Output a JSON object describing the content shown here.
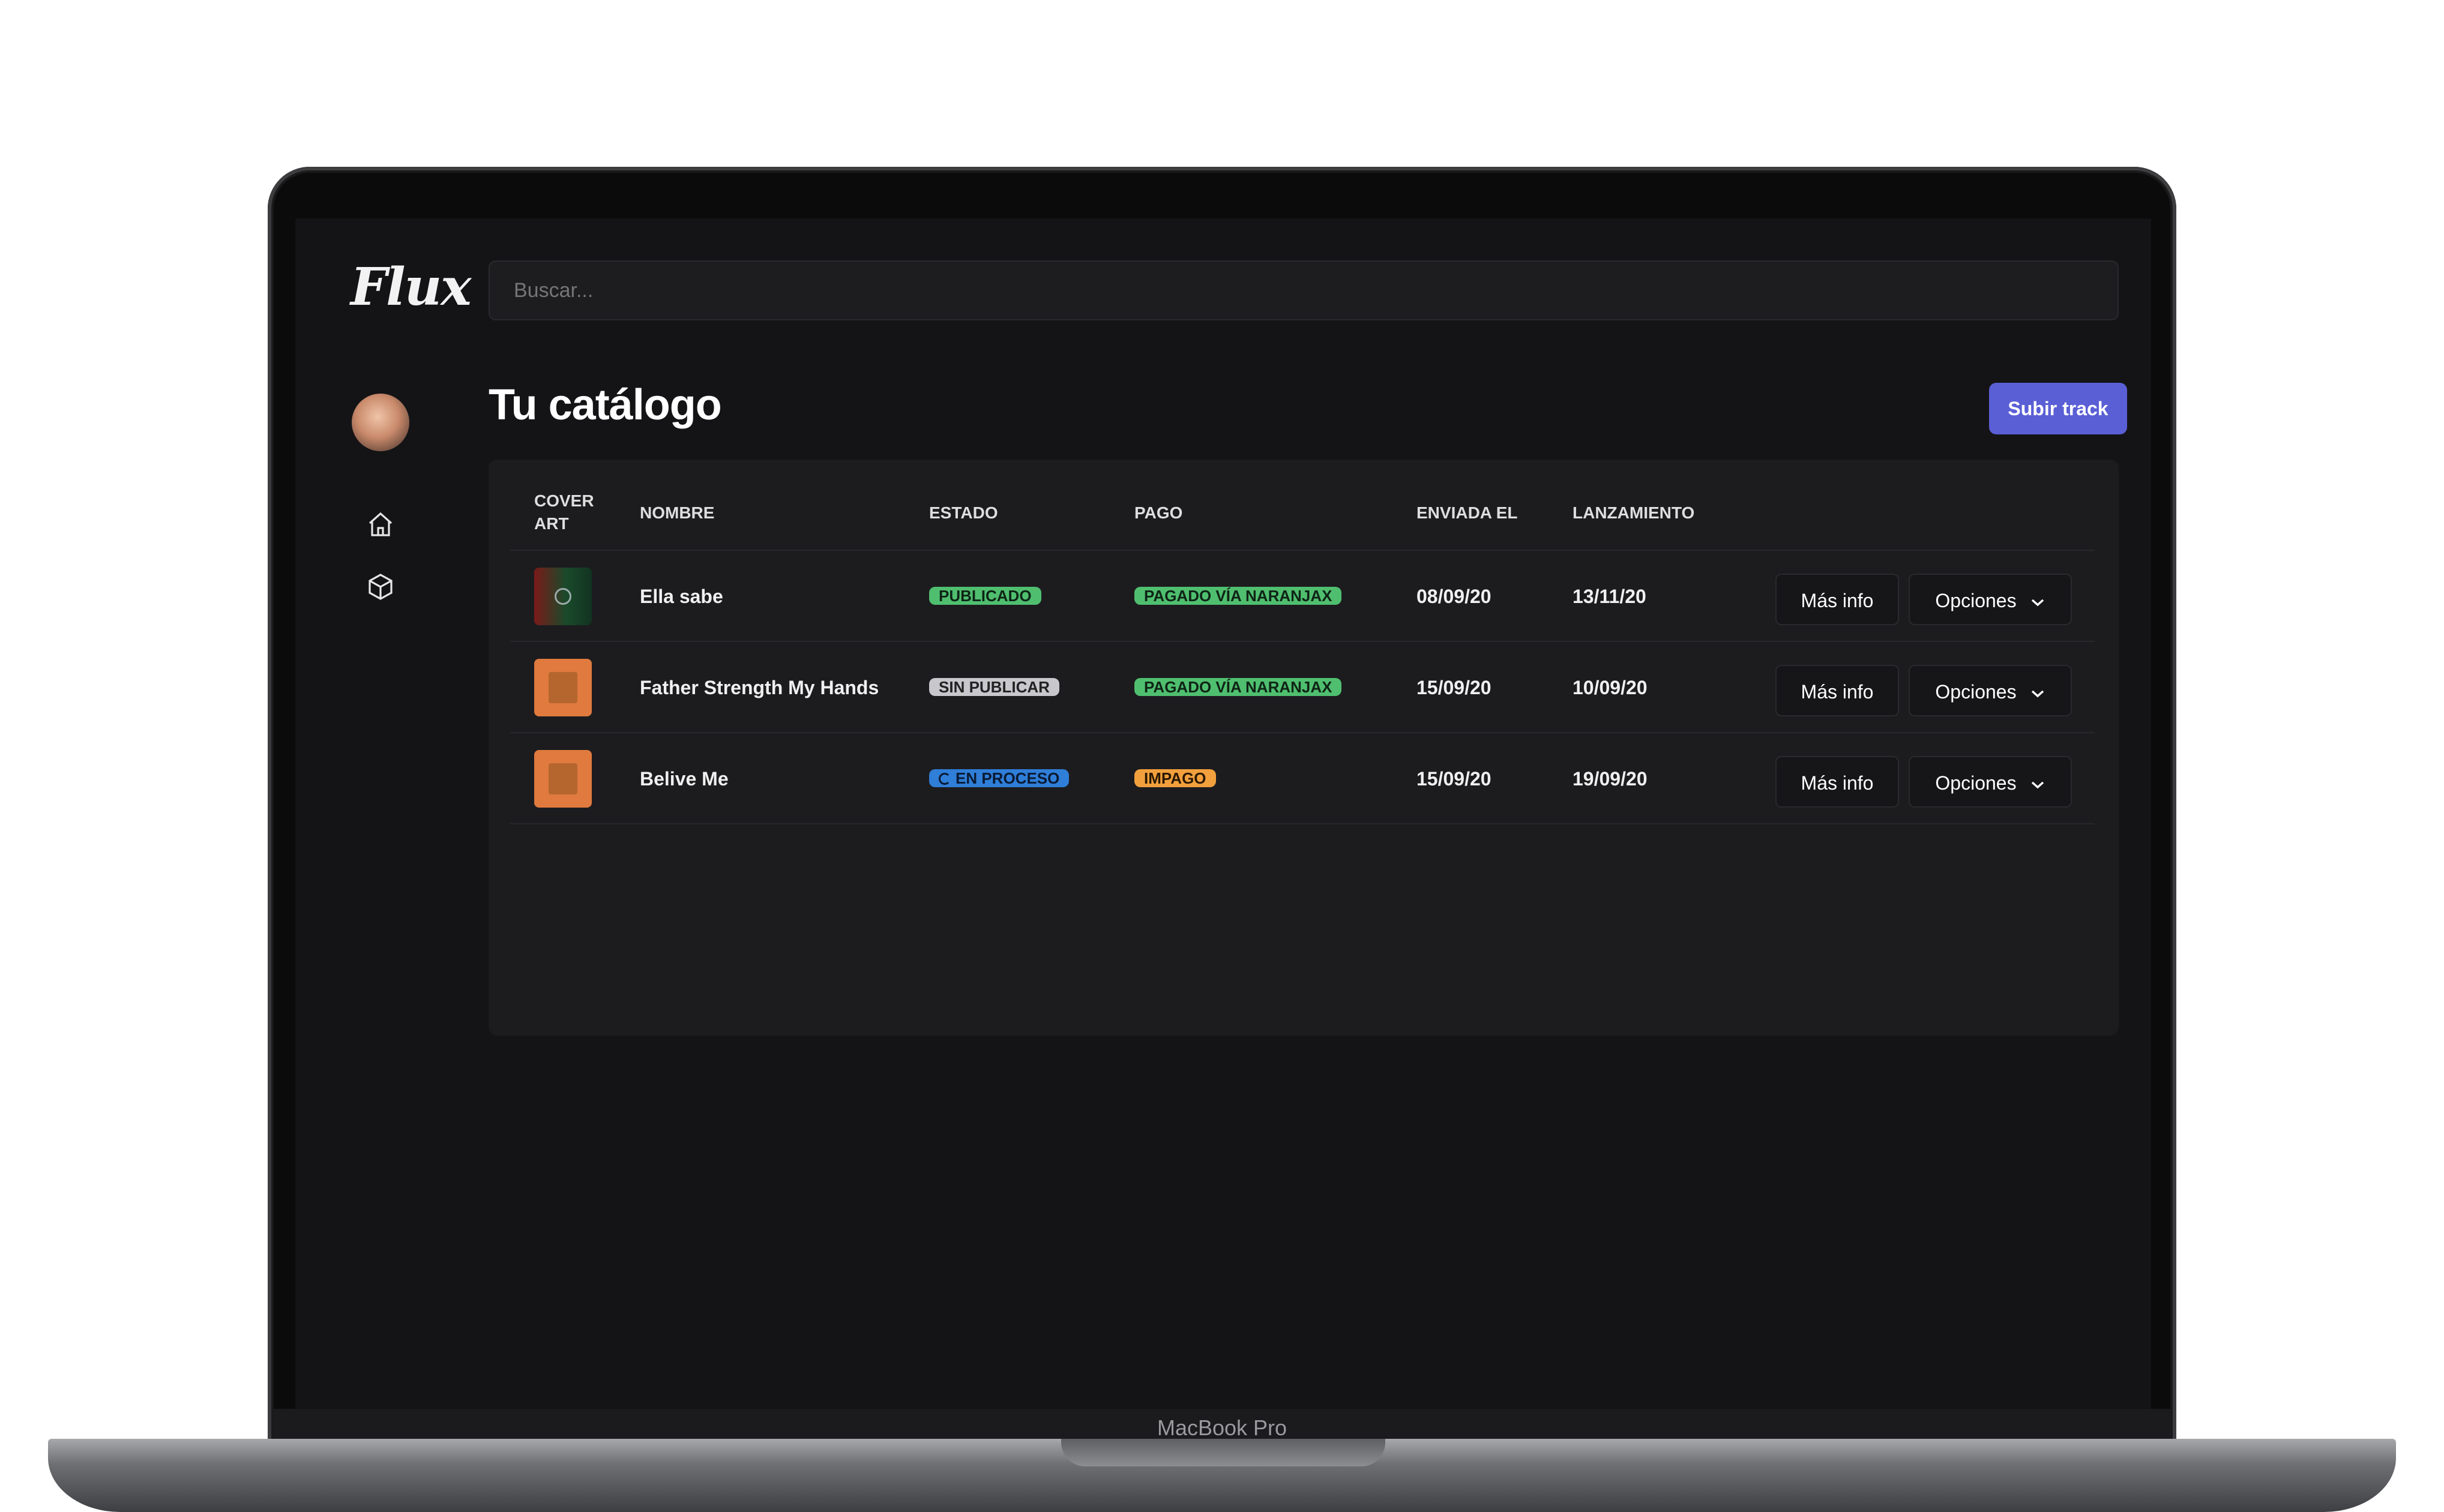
{
  "device_label": "MacBook Pro",
  "brand": "Flux",
  "search": {
    "placeholder": "Buscar..."
  },
  "page_title": "Tu catálogo",
  "upload_button": "Subir track",
  "table": {
    "headers": {
      "cover_line1": "COVER",
      "cover_line2": "ART",
      "name": "NOMBRE",
      "status": "ESTADO",
      "payment": "PAGO",
      "sent": "ENVIADA EL",
      "release": "LANZAMIENTO"
    },
    "rows": [
      {
        "name": "Ella sabe",
        "status": "PUBLICADO",
        "payment": "PAGADO VÍA NARANJAX",
        "sent": "08/09/20",
        "release": "13/11/20",
        "more": "Más info",
        "options": "Opciones"
      },
      {
        "name": "Father Strength My Hands",
        "status": "SIN PUBLICAR",
        "payment": "PAGADO VÍA NARANJAX",
        "sent": "15/09/20",
        "release": "10/09/20",
        "more": "Más info",
        "options": "Opciones"
      },
      {
        "name": "Belive Me",
        "status": "EN PROCESO",
        "payment": "IMPAGO",
        "sent": "15/09/20",
        "release": "19/09/20",
        "more": "Más info",
        "options": "Opciones"
      }
    ]
  },
  "colors": {
    "accent": "#5a5fd6",
    "success": "#4fbf6f",
    "info": "#2f7ed8",
    "warning": "#f2a03d"
  }
}
